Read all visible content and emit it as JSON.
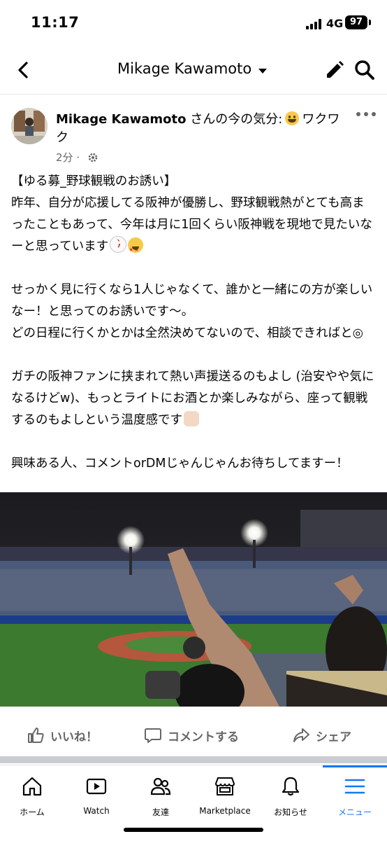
{
  "status_bar": {
    "time": "11:17",
    "network": "4G",
    "battery": "97"
  },
  "header": {
    "title": "Mikage Kawamoto"
  },
  "post": {
    "author": "Mikage Kawamoto",
    "feeling_prefix": "さんの今の気分:",
    "feeling": "ワクワク",
    "time": "2分",
    "privacy_icon": "gear-icon",
    "body": {
      "line1": "【ゆる募_野球観戦のお誘い】",
      "line2": "昨年、自分が応援してる阪神が優勝し、野球観戦熱がとても高まったこともあって、今年は月に1回くらい阪神戦を現地で見たいなーと思っています",
      "line3": "せっかく見に行くなら1人じゃなくて、誰かと一緒にの方が楽しいなー！と思ってのお誘いです〜。",
      "line4": "どの日程に行くかとかは全然決めてないので、相談できればと◎",
      "line5": "ガチの阪神ファンに挟まれて熱い声援送るのもよし (治安やや気になるけどw)、もっとライトにお酒とか楽しみながら、座って観戦するのもよしという温度感です",
      "line6": "興味ある人、コメントorDMじゃんじゃんお待ちしてますー！"
    }
  },
  "actions": {
    "like": "いいね！",
    "comment": "コメントする",
    "share": "シェア"
  },
  "tabs": [
    {
      "label": "ホーム",
      "icon": "home-icon"
    },
    {
      "label": "Watch",
      "icon": "watch-icon"
    },
    {
      "label": "友達",
      "icon": "friends-icon"
    },
    {
      "label": "Marketplace",
      "icon": "marketplace-icon"
    },
    {
      "label": "お知らせ",
      "icon": "bell-icon"
    },
    {
      "label": "メニュー",
      "icon": "menu-icon"
    }
  ],
  "colors": {
    "accent": "#1877f2",
    "secondary_text": "#65676b"
  }
}
